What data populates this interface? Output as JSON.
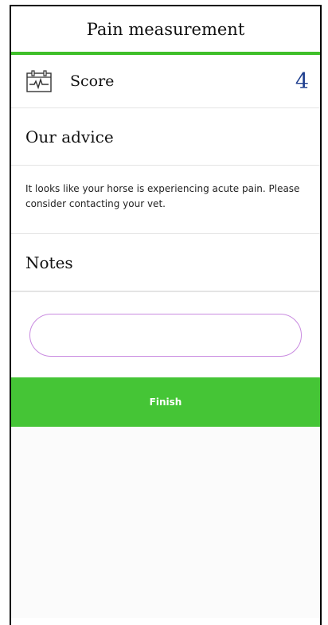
{
  "header": {
    "title": "Pain measurement"
  },
  "score": {
    "icon": "heart-monitor-calendar-icon",
    "label": "Score",
    "value": "4"
  },
  "advice": {
    "title": "Our advice",
    "text": "It looks like your horse is experiencing acute pain. Please consider contacting your vet."
  },
  "notes": {
    "title": "Notes",
    "value": "",
    "placeholder": ""
  },
  "actions": {
    "finish_label": "Finish"
  },
  "colors": {
    "accent_green": "#3fbf2a",
    "button_green": "#45c536",
    "score_blue": "#1f3f8f",
    "input_border": "#c98be0"
  }
}
